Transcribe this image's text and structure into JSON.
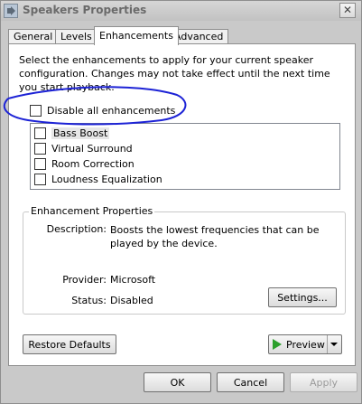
{
  "window": {
    "title": "Speakers Properties"
  },
  "tabs": [
    {
      "label": "General"
    },
    {
      "label": "Levels"
    },
    {
      "label": "Enhancements"
    },
    {
      "label": "Advanced"
    }
  ],
  "intro_text": "Select the enhancements to apply for your current speaker configuration. Changes may not take effect until the next time you start playback.",
  "disable_all": {
    "label": "Disable all enhancements",
    "checked": false
  },
  "enhancements": [
    {
      "label": "Bass Boost",
      "checked": false
    },
    {
      "label": "Virtual Surround",
      "checked": false
    },
    {
      "label": "Room Correction",
      "checked": false
    },
    {
      "label": "Loudness Equalization",
      "checked": false
    }
  ],
  "properties": {
    "title": "Enhancement Properties",
    "description_label": "Description:",
    "description_value": "Boosts the lowest frequencies that can be played by the device.",
    "provider_label": "Provider:",
    "provider_value": "Microsoft",
    "status_label": "Status:",
    "status_value": "Disabled",
    "settings_button": "Settings..."
  },
  "buttons": {
    "restore_defaults": "Restore Defaults",
    "preview": "Preview",
    "ok": "OK",
    "cancel": "Cancel",
    "apply": "Apply"
  },
  "annotation_color": "#1d23d6",
  "icons": {
    "title": "speaker-icon",
    "preview": "play-icon"
  }
}
